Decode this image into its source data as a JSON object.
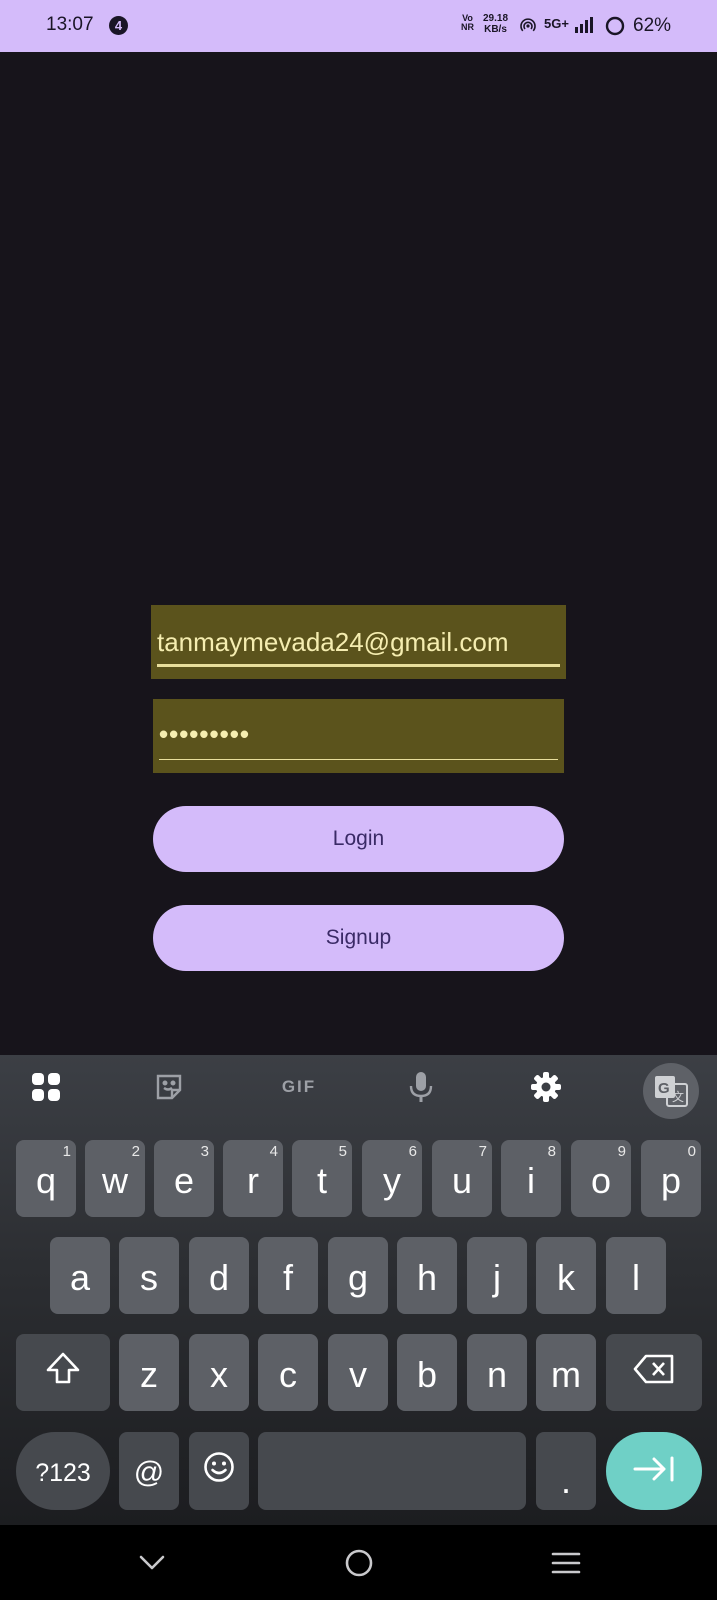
{
  "status_bar": {
    "time": "13:07",
    "notification_count": "4",
    "volte_line1": "Vo",
    "volte_line2": "NR",
    "speed_value": "29.18",
    "speed_unit": "KB/s",
    "network": "5G+",
    "battery": "62%"
  },
  "login_form": {
    "email_value": "tanmaymevada24@gmail.com",
    "password_value": "•••••••••",
    "login_label": "Login",
    "signup_label": "Signup"
  },
  "keyboard": {
    "toolbar": {
      "gif_label": "GIF",
      "icons": [
        "apps-grid-icon",
        "sticker-icon",
        "microphone-icon",
        "gear-icon",
        "translate-icon"
      ]
    },
    "row1": [
      {
        "key": "q",
        "hint": "1"
      },
      {
        "key": "w",
        "hint": "2"
      },
      {
        "key": "e",
        "hint": "3"
      },
      {
        "key": "r",
        "hint": "4"
      },
      {
        "key": "t",
        "hint": "5"
      },
      {
        "key": "y",
        "hint": "6"
      },
      {
        "key": "u",
        "hint": "7"
      },
      {
        "key": "i",
        "hint": "8"
      },
      {
        "key": "o",
        "hint": "9"
      },
      {
        "key": "p",
        "hint": "0"
      }
    ],
    "row2": [
      "a",
      "s",
      "d",
      "f",
      "g",
      "h",
      "j",
      "k",
      "l"
    ],
    "row3": [
      "z",
      "x",
      "c",
      "v",
      "b",
      "n",
      "m"
    ],
    "symbols_label": "?123",
    "at_label": "@",
    "period_label": ".",
    "accent_color": "#6fd0c6"
  },
  "colors": {
    "background": "#17141b",
    "primary": "#d4bbfa",
    "field_fill": "#5b531c"
  }
}
